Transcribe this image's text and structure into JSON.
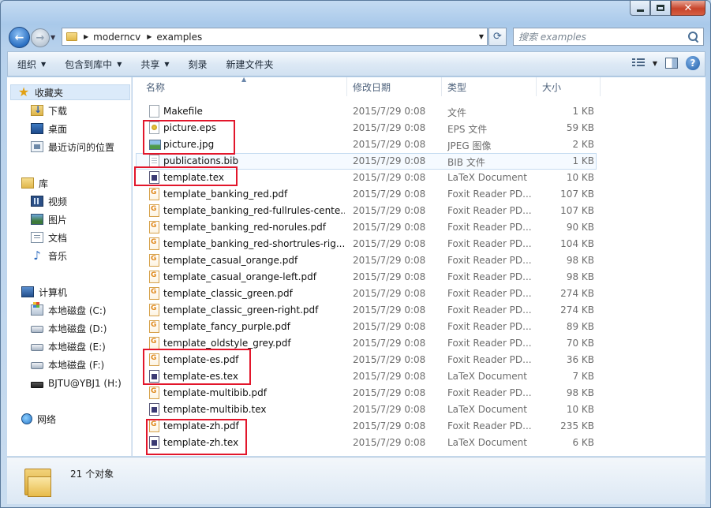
{
  "nav": {
    "address": [
      "moderncv",
      "examples"
    ],
    "search_placeholder": "搜索 examples"
  },
  "toolbar": {
    "organize": "组织",
    "include": "包含到库中",
    "share": "共享",
    "burn": "刻录",
    "new_folder": "新建文件夹"
  },
  "sidebar": {
    "favorites": "收藏夹",
    "downloads": "下载",
    "desktop": "桌面",
    "recent": "最近访问的位置",
    "libraries": "库",
    "videos": "视频",
    "pictures": "图片",
    "documents": "文档",
    "music": "音乐",
    "computer": "计算机",
    "drive_c": "本地磁盘 (C:)",
    "drive_d": "本地磁盘 (D:)",
    "drive_e": "本地磁盘 (E:)",
    "drive_f": "本地磁盘 (F:)",
    "drive_h": "BJTU@YBJ1 (H:)",
    "network": "网络"
  },
  "columns": {
    "name": "名称",
    "date": "修改日期",
    "type": "类型",
    "size": "大小"
  },
  "files": [
    {
      "name": "Makefile",
      "date": "2015/7/29 0:08",
      "type": "文件",
      "size": "1 KB",
      "icon": "blank"
    },
    {
      "name": "picture.eps",
      "date": "2015/7/29 0:08",
      "type": "EPS 文件",
      "size": "59 KB",
      "icon": "eps"
    },
    {
      "name": "picture.jpg",
      "date": "2015/7/29 0:08",
      "type": "JPEG 图像",
      "size": "2 KB",
      "icon": "jpg"
    },
    {
      "name": "publications.bib",
      "date": "2015/7/29 0:08",
      "type": "BIB 文件",
      "size": "1 KB",
      "icon": "bib"
    },
    {
      "name": "template.tex",
      "date": "2015/7/29 0:08",
      "type": "LaTeX Document",
      "size": "10 KB",
      "icon": "tex"
    },
    {
      "name": "template_banking_red.pdf",
      "date": "2015/7/29 0:08",
      "type": "Foxit Reader PD...",
      "size": "107 KB",
      "icon": "pdf"
    },
    {
      "name": "template_banking_red-fullrules-cente...",
      "date": "2015/7/29 0:08",
      "type": "Foxit Reader PD...",
      "size": "107 KB",
      "icon": "pdf"
    },
    {
      "name": "template_banking_red-norules.pdf",
      "date": "2015/7/29 0:08",
      "type": "Foxit Reader PD...",
      "size": "90 KB",
      "icon": "pdf"
    },
    {
      "name": "template_banking_red-shortrules-rig...",
      "date": "2015/7/29 0:08",
      "type": "Foxit Reader PD...",
      "size": "104 KB",
      "icon": "pdf"
    },
    {
      "name": "template_casual_orange.pdf",
      "date": "2015/7/29 0:08",
      "type": "Foxit Reader PD...",
      "size": "98 KB",
      "icon": "pdf"
    },
    {
      "name": "template_casual_orange-left.pdf",
      "date": "2015/7/29 0:08",
      "type": "Foxit Reader PD...",
      "size": "98 KB",
      "icon": "pdf"
    },
    {
      "name": "template_classic_green.pdf",
      "date": "2015/7/29 0:08",
      "type": "Foxit Reader PD...",
      "size": "274 KB",
      "icon": "pdf"
    },
    {
      "name": "template_classic_green-right.pdf",
      "date": "2015/7/29 0:08",
      "type": "Foxit Reader PD...",
      "size": "274 KB",
      "icon": "pdf"
    },
    {
      "name": "template_fancy_purple.pdf",
      "date": "2015/7/29 0:08",
      "type": "Foxit Reader PD...",
      "size": "89 KB",
      "icon": "pdf"
    },
    {
      "name": "template_oldstyle_grey.pdf",
      "date": "2015/7/29 0:08",
      "type": "Foxit Reader PD...",
      "size": "70 KB",
      "icon": "pdf"
    },
    {
      "name": "template-es.pdf",
      "date": "2015/7/29 0:08",
      "type": "Foxit Reader PD...",
      "size": "36 KB",
      "icon": "pdf"
    },
    {
      "name": "template-es.tex",
      "date": "2015/7/29 0:08",
      "type": "LaTeX Document",
      "size": "7 KB",
      "icon": "tex"
    },
    {
      "name": "template-multibib.pdf",
      "date": "2015/7/29 0:08",
      "type": "Foxit Reader PD...",
      "size": "98 KB",
      "icon": "pdf"
    },
    {
      "name": "template-multibib.tex",
      "date": "2015/7/29 0:08",
      "type": "LaTeX Document",
      "size": "10 KB",
      "icon": "tex"
    },
    {
      "name": "template-zh.pdf",
      "date": "2015/7/29 0:08",
      "type": "Foxit Reader PD...",
      "size": "235 KB",
      "icon": "pdf"
    },
    {
      "name": "template-zh.tex",
      "date": "2015/7/29 0:08",
      "type": "LaTeX Document",
      "size": "6 KB",
      "icon": "tex"
    }
  ],
  "status": {
    "count": "21 个对象"
  },
  "colors": {
    "annotation": "#e2162b",
    "accent": "#2a6fc2"
  }
}
